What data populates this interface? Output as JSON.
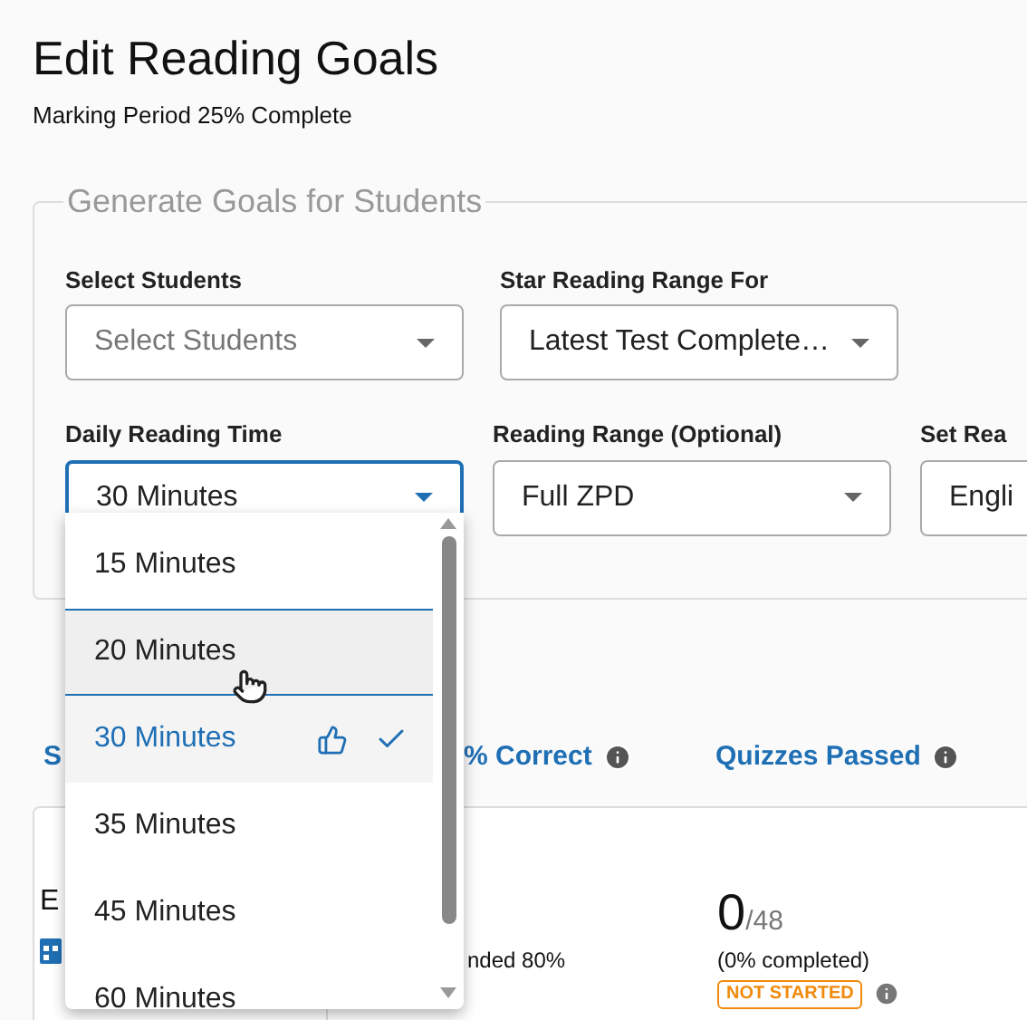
{
  "page": {
    "title": "Edit Reading Goals",
    "subtitle": "Marking Period 25% Complete"
  },
  "goal_generator": {
    "legend": "Generate Goals for Students",
    "fields": [
      {
        "label": "Select Students",
        "placeholder": "Select Students",
        "open": false
      },
      {
        "label": "Star Reading Range For",
        "value": "Latest Test Complete…",
        "open": false
      },
      {
        "label": "Daily Reading Time",
        "value": "30 Minutes",
        "open": true
      },
      {
        "label": "Reading Range (Optional)",
        "value": "Full ZPD",
        "open": false
      },
      {
        "label": "Set Rea",
        "value": "Engli",
        "open": false
      }
    ]
  },
  "dropdown": {
    "options": [
      {
        "label": "15 Minutes",
        "selected": false,
        "focused": false,
        "recommended": false
      },
      {
        "label": "20 Minutes",
        "selected": false,
        "focused": true,
        "recommended": false
      },
      {
        "label": "30 Minutes",
        "selected": true,
        "focused": false,
        "recommended": true
      },
      {
        "label": "35 Minutes",
        "selected": false,
        "focused": false,
        "recommended": false
      },
      {
        "label": "45 Minutes",
        "selected": false,
        "focused": false,
        "recommended": false
      },
      {
        "label": "60 Minutes",
        "selected": false,
        "focused": false,
        "recommended": false
      }
    ]
  },
  "table": {
    "columns": [
      {
        "label": "S",
        "info": false
      },
      {
        "label": "% Correct",
        "info": true
      },
      {
        "label": "Quizzes Passed",
        "info": true
      }
    ],
    "rows": [
      {
        "column_1": "E",
        "column_2": "nded 80%",
        "quizzes_passed": "0",
        "quizzes_total": "/48",
        "completion": "(0% completed)",
        "status": "NOT STARTED"
      }
    ]
  }
}
